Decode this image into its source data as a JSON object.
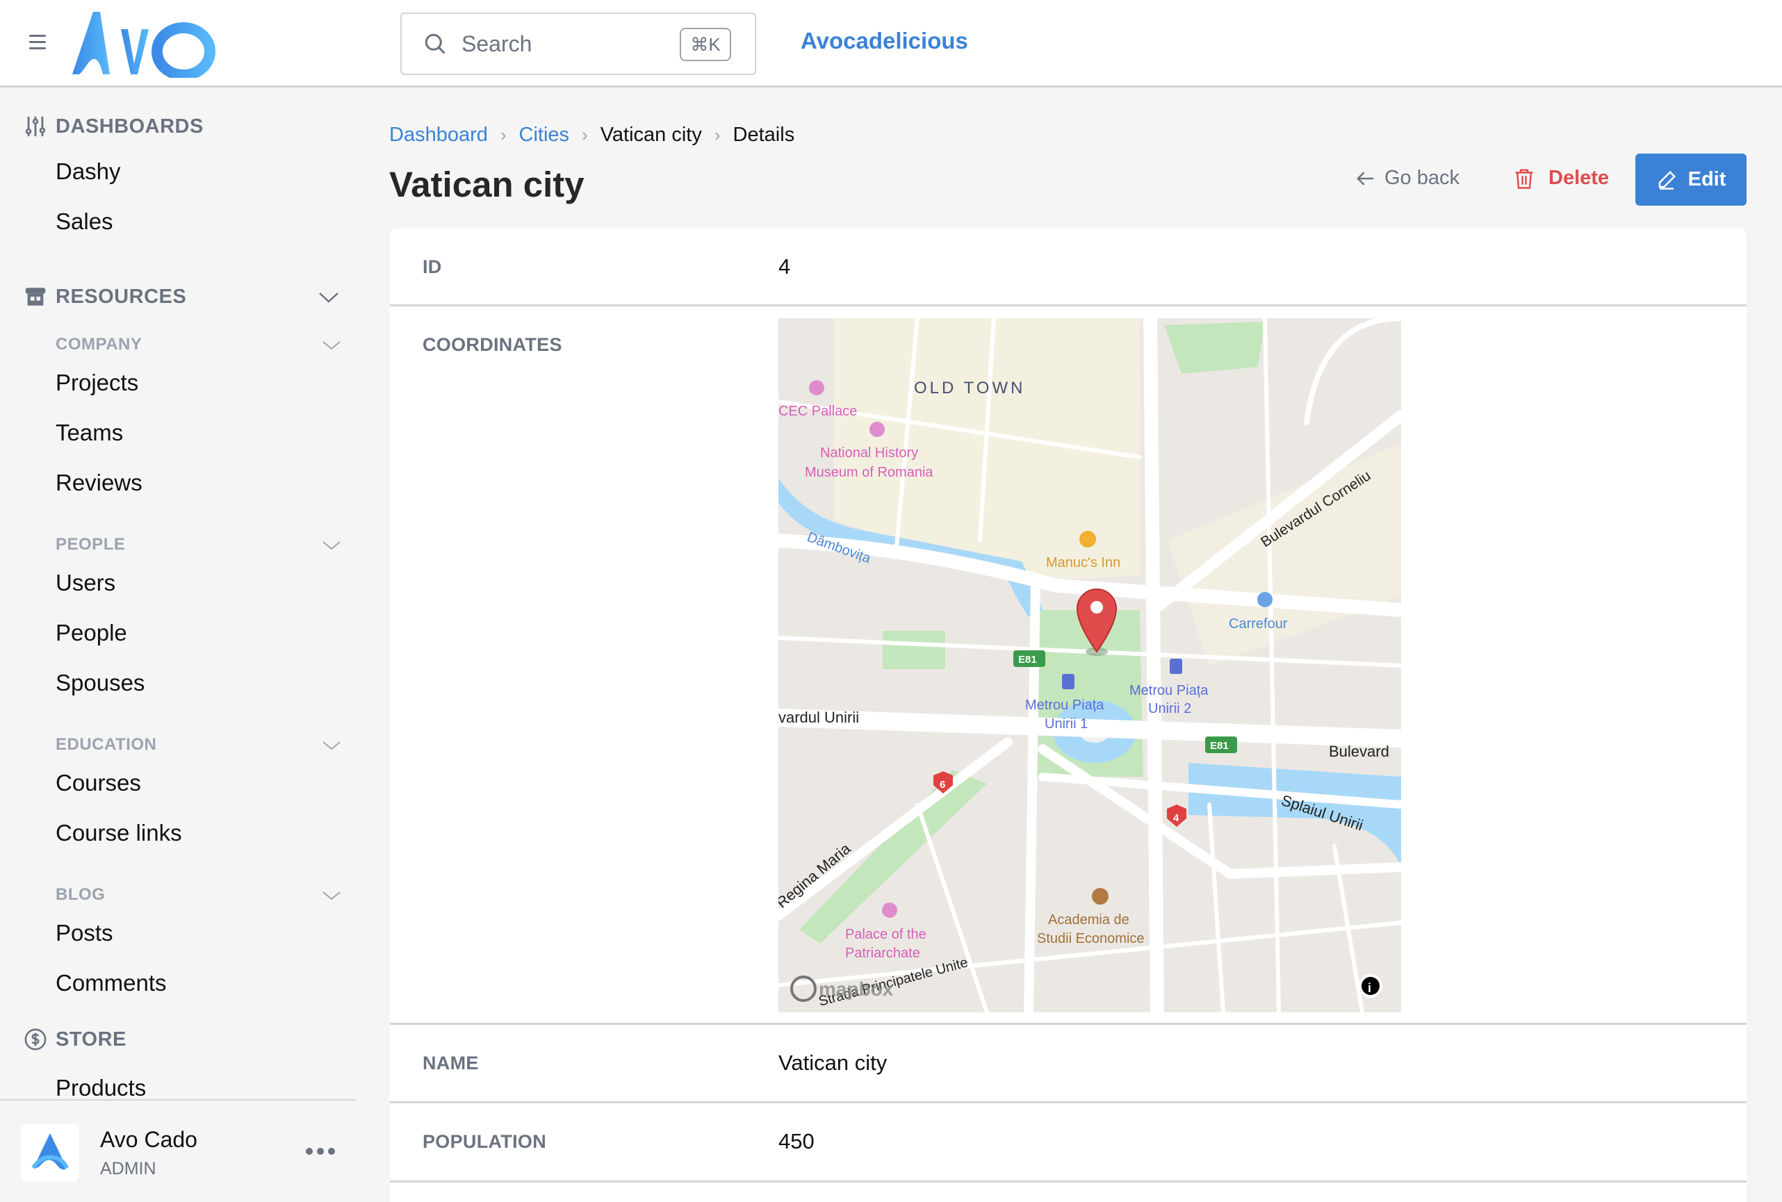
{
  "header": {
    "app_name": "Avocadelicious",
    "search": {
      "placeholder": "Search",
      "shortcut": "⌘K"
    },
    "icons": {
      "menu": "hamburger-icon",
      "search": "search-icon",
      "logo": "avo-logo"
    }
  },
  "sidebar": {
    "dashboards": {
      "label": "DASHBOARDS",
      "icon": "sliders-icon",
      "items": [
        "Dashy",
        "Sales"
      ]
    },
    "resources": {
      "label": "RESOURCES",
      "icon": "storefront-icon",
      "groups": [
        {
          "label": "COMPANY",
          "items": [
            "Projects",
            "Teams",
            "Reviews"
          ]
        },
        {
          "label": "PEOPLE",
          "items": [
            "Users",
            "People",
            "Spouses"
          ]
        },
        {
          "label": "EDUCATION",
          "items": [
            "Courses",
            "Course links"
          ]
        },
        {
          "label": "BLOG",
          "items": [
            "Posts",
            "Comments"
          ]
        }
      ]
    },
    "store": {
      "label": "STORE",
      "icon": "dollar-circle-icon",
      "items": [
        "Products"
      ]
    },
    "user": {
      "name": "Avo Cado",
      "role": "ADMIN"
    }
  },
  "breadcrumb": [
    {
      "label": "Dashboard",
      "link": true
    },
    {
      "label": "Cities",
      "link": true
    },
    {
      "label": "Vatican city",
      "link": false
    },
    {
      "label": "Details",
      "link": false
    }
  ],
  "page": {
    "title": "Vatican city",
    "actions": {
      "back": "Go back",
      "delete": "Delete",
      "edit": "Edit"
    }
  },
  "fields": [
    {
      "label": "ID",
      "value": "4"
    },
    {
      "label": "COORDINATES",
      "value": ""
    },
    {
      "label": "NAME",
      "value": "Vatican city"
    },
    {
      "label": "POPULATION",
      "value": "450"
    }
  ],
  "map": {
    "district": "OLD TOWN",
    "pois": [
      {
        "label": "CEC Pallace",
        "color": "#d65fb8"
      },
      {
        "label": "National History Museum of Romania",
        "color": "#d65fb8"
      },
      {
        "label": "Manuc's Inn",
        "color": "#d39a2e"
      },
      {
        "label": "Carrefour",
        "color": "#4a8ad6"
      },
      {
        "label": "Metrou Piața Unirii 1",
        "color": "#5a6fd6"
      },
      {
        "label": "Metrou Piața Unirii 2",
        "color": "#5a6fd6"
      },
      {
        "label": "Palace of the Patriarchate",
        "color": "#d65fb8"
      },
      {
        "label": "Academia de Studii Economice",
        "color": "#a0703a"
      }
    ],
    "streets": [
      "Dâmbovița",
      "Bulevardul Corneliu",
      "vardul Unirii",
      "Bulevard",
      "Splaiul Unirii",
      "Regina Maria",
      "Strada Principatele Unite"
    ],
    "road_shields": [
      "E81",
      "E81",
      "6",
      "4"
    ],
    "attribution": "mapbox",
    "marker_color": "#e04b4b"
  }
}
